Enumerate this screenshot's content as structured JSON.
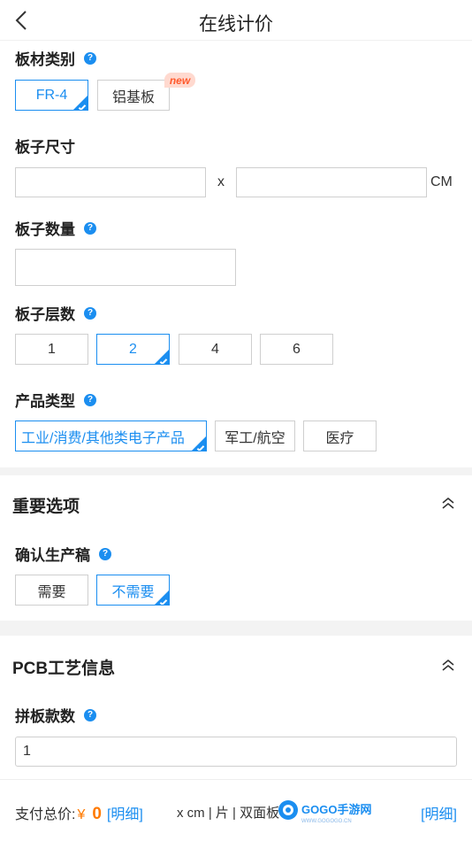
{
  "header": {
    "title": "在线计价"
  },
  "board_type": {
    "label": "板材类别",
    "options": [
      "FR-4",
      "铝基板"
    ],
    "selected": "FR-4",
    "new_badge": "new"
  },
  "board_size": {
    "label": "板子尺寸",
    "sep": "x",
    "unit": "CM",
    "width_value": "",
    "length_value": ""
  },
  "board_qty": {
    "label": "板子数量",
    "value": ""
  },
  "board_layers": {
    "label": "板子层数",
    "options": [
      "1",
      "2",
      "4",
      "6"
    ],
    "selected": "2"
  },
  "product_type": {
    "label": "产品类型",
    "options": [
      "工业/消费/其他类电子产品",
      "军工/航空",
      "医疗"
    ],
    "selected": "工业/消费/其他类电子产品"
  },
  "important": {
    "title": "重要选项",
    "confirm_label": "确认生产稿",
    "options": [
      "需要",
      "不需要"
    ],
    "selected": "不需要"
  },
  "pcb": {
    "title": "PCB工艺信息",
    "panel_label": "拼板款数",
    "panel_value": "1"
  },
  "footer": {
    "total_label": "支付总价:",
    "currency": "¥",
    "amount": "0",
    "detail_link": "[明细]",
    "spec": "x cm | 片 | 双面板",
    "detail_link_right": "[明细]"
  },
  "watermark": {
    "text": "GOGO手游网",
    "sub": "WWW.GOGOGO.CN"
  },
  "colors": {
    "accent": "#1b8ef0",
    "price": "#ff7a00",
    "badge_text": "#ff5a2d",
    "badge_bg": "#ffd9cf",
    "gap": "#f3f3f3"
  }
}
